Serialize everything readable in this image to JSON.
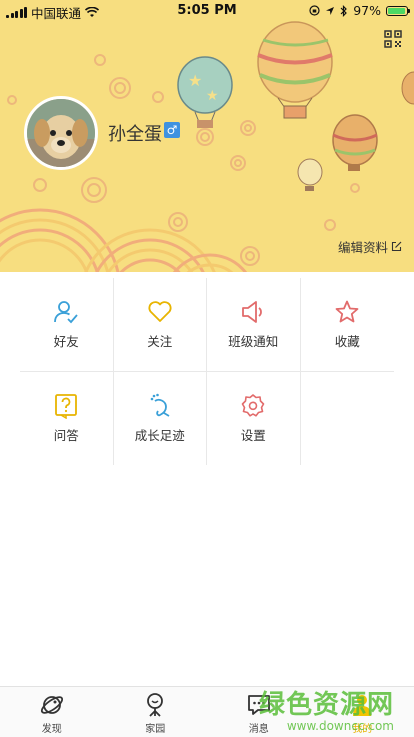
{
  "status_bar": {
    "carrier": "中国联通",
    "time": "5:05 PM",
    "battery": "97%",
    "battery_level": 0.97
  },
  "profile": {
    "username": "孙全蛋",
    "gender_symbol": "♂",
    "edit_label": "编辑资料"
  },
  "grid": {
    "items": [
      {
        "label": "好友",
        "icon": "friend-icon",
        "color": "#3aa0d8"
      },
      {
        "label": "关注",
        "icon": "heart-icon",
        "color": "#e8b400"
      },
      {
        "label": "班级通知",
        "icon": "megaphone-icon",
        "color": "#e26b6b"
      },
      {
        "label": "收藏",
        "icon": "star-icon",
        "color": "#e26b6b"
      },
      {
        "label": "问答",
        "icon": "question-icon",
        "color": "#e8b400"
      },
      {
        "label": "成长足迹",
        "icon": "footprint-icon",
        "color": "#3aa0d8"
      },
      {
        "label": "设置",
        "icon": "settings-icon",
        "color": "#e26b6b"
      }
    ]
  },
  "tabbar": {
    "tabs": [
      {
        "label": "发现",
        "icon": "planet-icon"
      },
      {
        "label": "家园",
        "icon": "home-tree-icon"
      },
      {
        "label": "消息",
        "icon": "message-icon"
      },
      {
        "label": "我的",
        "icon": "user-icon",
        "active": true
      }
    ]
  },
  "watermark": {
    "title": "绿色资源网",
    "url": "www.downcc.com"
  },
  "colors": {
    "header_bg": "#f7de80",
    "accent_yellow": "#e8b400",
    "accent_blue": "#3aa0d8",
    "accent_red": "#e26b6b"
  }
}
